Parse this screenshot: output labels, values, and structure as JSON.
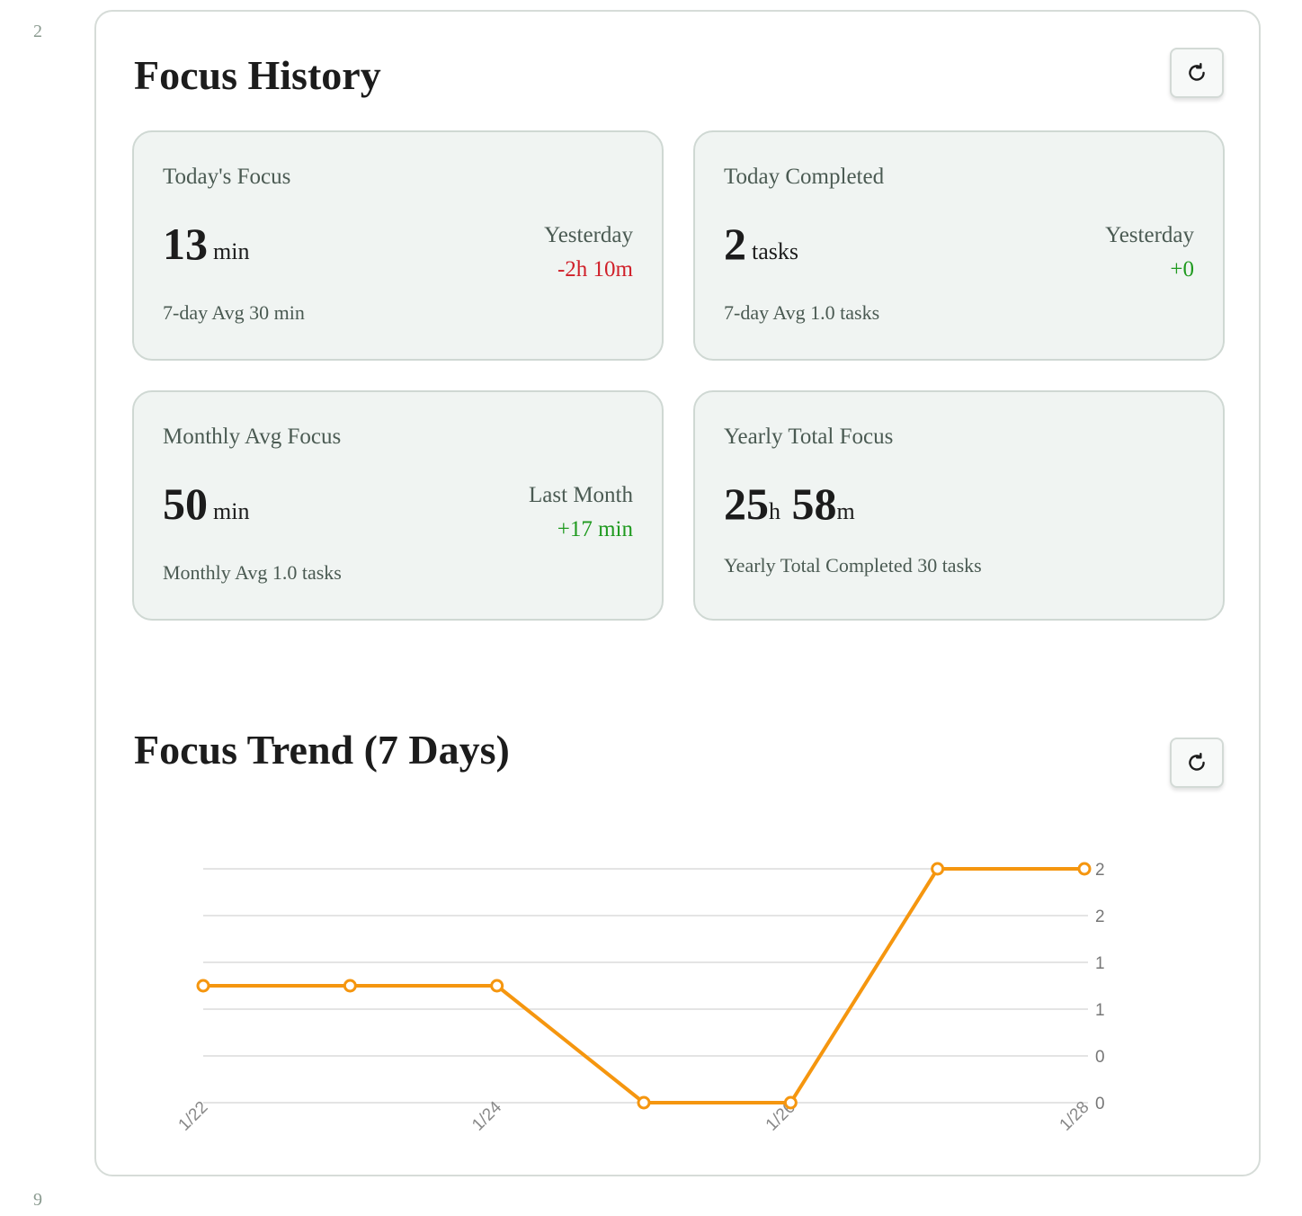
{
  "gutter": {
    "top_number": "2",
    "bottom_number": "9"
  },
  "focus_history": {
    "title": "Focus History",
    "refresh_icon": "refresh-icon",
    "cards": {
      "today_focus": {
        "label": "Today's Focus",
        "value": "13",
        "unit": "min",
        "compare_label": "Yesterday",
        "compare_value": "-2h 10m",
        "footer": "7-day Avg 30 min"
      },
      "today_completed": {
        "label": "Today Completed",
        "value": "2",
        "unit": "tasks",
        "compare_label": "Yesterday",
        "compare_value": "+0",
        "footer": "7-day Avg 1.0 tasks"
      },
      "monthly_avg": {
        "label": "Monthly Avg Focus",
        "value": "50",
        "unit": "min",
        "compare_label": "Last Month",
        "compare_value": "+17 min",
        "footer": "Monthly Avg 1.0 tasks"
      },
      "yearly_total": {
        "label": "Yearly Total Focus",
        "hours": "25",
        "hours_unit": "h",
        "minutes": "58",
        "minutes_unit": "m",
        "footer": "Yearly Total Completed 30 tasks"
      }
    }
  },
  "focus_trend": {
    "title": "Focus Trend (7 Days)",
    "refresh_icon": "refresh-icon"
  },
  "colors": {
    "line": "#f5960f",
    "negative": "#d0202a",
    "positive": "#1f9a1f",
    "card_bg": "#f0f4f2"
  },
  "chart_data": {
    "type": "line",
    "x": [
      "1/22",
      "1/23",
      "1/24",
      "1/25",
      "1/26",
      "1/27",
      "1/28"
    ],
    "x_tick_labels": [
      "1/22",
      "1/24",
      "1/26",
      "1/28"
    ],
    "series": [
      {
        "values": [
          1,
          1,
          1,
          0,
          0,
          2,
          2
        ]
      }
    ],
    "y_tick_labels": [
      "0",
      "0",
      "1",
      "1",
      "2",
      "2"
    ],
    "ylim": [
      0,
      2
    ],
    "y_axis_side": "right",
    "grid": true,
    "title": "",
    "xlabel": "",
    "ylabel": ""
  }
}
